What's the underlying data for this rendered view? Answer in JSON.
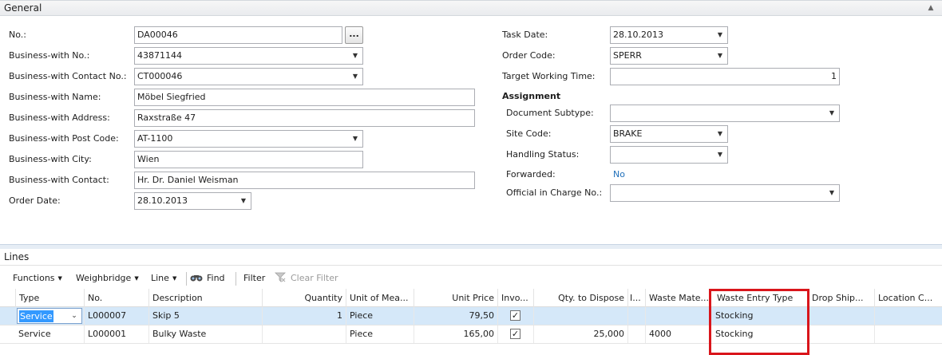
{
  "general": {
    "title": "General",
    "left_fields": [
      {
        "label": "No.:",
        "value": "DA00046"
      },
      {
        "label": "Business-with No.:",
        "value": "43871144"
      },
      {
        "label": "Business-with Contact No.:",
        "value": "CT000046"
      },
      {
        "label": "Business-with Name:",
        "value": "Möbel Siegfried"
      },
      {
        "label": "Business-with Address:",
        "value": "Raxstraße 47"
      },
      {
        "label": "Business-with Post Code:",
        "value": "AT-1100"
      },
      {
        "label": "Business-with City:",
        "value": "Wien"
      },
      {
        "label": "Business-with Contact:",
        "value": "Hr. Dr. Daniel Weisman"
      },
      {
        "label": "Order Date:",
        "value": "28.10.2013"
      }
    ],
    "ellipsis_label": "...",
    "right_fields": [
      {
        "label": "Task Date:",
        "value": "28.10.2013"
      },
      {
        "label": "Order Code:",
        "value": "SPERR"
      },
      {
        "label": "Target Working Time:",
        "value": "1"
      }
    ],
    "assignment": {
      "title": "Assignment",
      "fields": [
        {
          "label": "Document Subtype:",
          "value": ""
        },
        {
          "label": "Site Code:",
          "value": "BRAKE"
        },
        {
          "label": "Handling Status:",
          "value": ""
        },
        {
          "label": "Forwarded:",
          "value": "No"
        },
        {
          "label": "Official in Charge No.:",
          "value": ""
        }
      ]
    }
  },
  "lines": {
    "title": "Lines",
    "toolbar": {
      "functions": "Functions",
      "weighbridge": "Weighbridge",
      "line": "Line",
      "find": "Find",
      "filter": "Filter",
      "clear_filter": "Clear Filter"
    },
    "columns": [
      "Type",
      "No.",
      "Description",
      "Quantity",
      "Unit of Mea...",
      "Unit Price",
      "Invo...",
      "Qty. to Dispose",
      "I...",
      "Waste Mate...",
      "Waste Entry Type",
      "Drop Ship...",
      "Location C..."
    ],
    "rows": [
      {
        "type": "Service",
        "no": "L000007",
        "description": "Skip 5",
        "quantity": "1",
        "unit": "Piece",
        "unit_price": "79,50",
        "invoice": true,
        "qty_dispose": "",
        "waste_material": "",
        "waste_entry_type": "Stocking",
        "drop_ship": "",
        "location": ""
      },
      {
        "type": "Service",
        "no": "L000001",
        "description": "Bulky Waste",
        "quantity": "",
        "unit": "Piece",
        "unit_price": "165,00",
        "invoice": true,
        "qty_dispose": "25,000",
        "waste_material": "4000",
        "waste_entry_type": "Stocking",
        "drop_ship": "",
        "location": ""
      }
    ]
  },
  "colors": {
    "highlight_box": "#d9151b",
    "selected_row": "#d5e8f9",
    "link": "#1f6fba"
  }
}
